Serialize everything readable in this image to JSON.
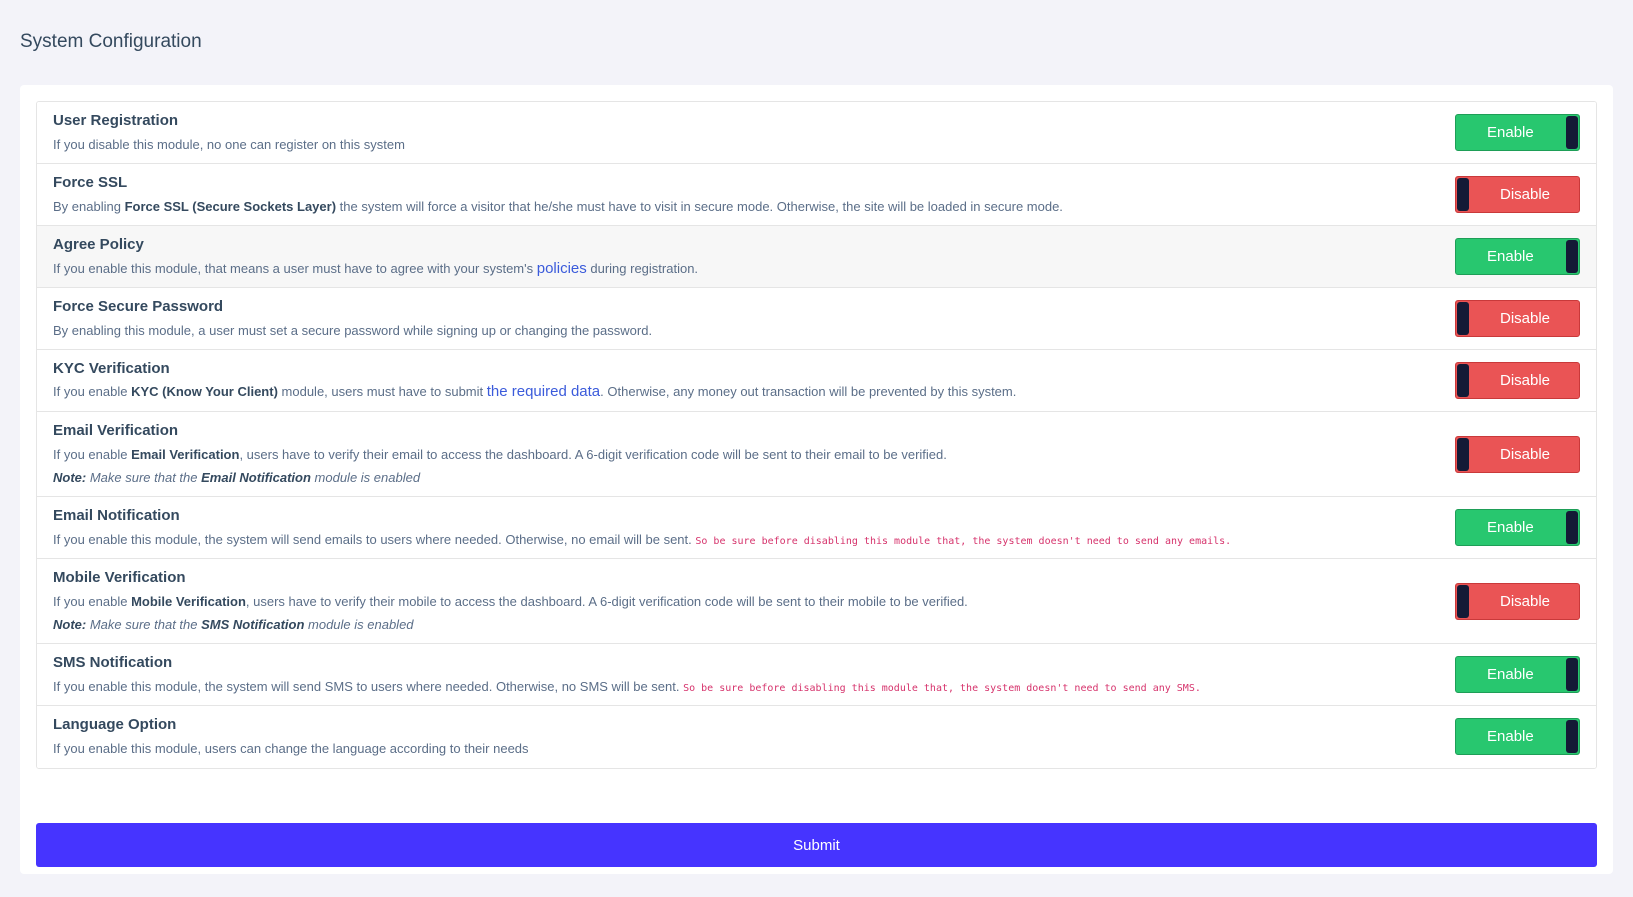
{
  "page": {
    "title": "System Configuration"
  },
  "modules": [
    {
      "title": "User Registration",
      "desc": "If you disable this module, no one can register on this system",
      "state": "Enable"
    },
    {
      "title": "Force SSL",
      "desc_pre": "By enabling ",
      "desc_bold": "Force SSL (Secure Sockets Layer)",
      "desc_post": " the system will force a visitor that he/she must have to visit in secure mode. Otherwise, the site will be loaded in secure mode.",
      "state": "Disable"
    },
    {
      "title": "Agree Policy",
      "desc_pre": "If you enable this module, that means a user must have to agree with your system's ",
      "desc_link": "policies",
      "desc_post": " during registration.",
      "state": "Enable"
    },
    {
      "title": "Force Secure Password",
      "desc": "By enabling this module, a user must set a secure password while signing up or changing the password.",
      "state": "Disable"
    },
    {
      "title": "KYC Verification",
      "desc_pre": "If you enable ",
      "desc_bold": "KYC (Know Your Client)",
      "desc_mid": " module, users must have to submit ",
      "desc_link": "the required data",
      "desc_post": ". Otherwise, any money out transaction will be prevented by this system.",
      "state": "Disable"
    },
    {
      "title": "Email Verification",
      "desc_pre": "If you enable ",
      "desc_bold": "Email Verification",
      "desc_post": ", users have to verify their email to access the dashboard. A 6-digit verification code will be sent to their email to be verified.",
      "note_label": "Note:",
      "note_pre": " Make sure that the ",
      "note_bold": "Email Notification",
      "note_post": " module is enabled",
      "state": "Disable"
    },
    {
      "title": "Email Notification",
      "desc": "If you enable this module, the system will send emails to users where needed. Otherwise, no email will be sent. ",
      "desc_code": "So be sure before disabling this module that, the system doesn't need to send any emails.",
      "state": "Enable"
    },
    {
      "title": "Mobile Verification",
      "desc_pre": "If you enable ",
      "desc_bold": "Mobile Verification",
      "desc_post": ", users have to verify their mobile to access the dashboard. A 6-digit verification code will be sent to their mobile to be verified.",
      "note_label": "Note:",
      "note_pre": " Make sure that the ",
      "note_bold": "SMS Notification",
      "note_post": " module is enabled",
      "state": "Disable"
    },
    {
      "title": "SMS Notification",
      "desc": "If you enable this module, the system will send SMS to users where needed. Otherwise, no SMS will be sent. ",
      "desc_code": "So be sure before disabling this module that, the system doesn't need to send any SMS.",
      "state": "Enable"
    },
    {
      "title": "Language Option",
      "desc": "If you enable this module, users can change the language according to their needs",
      "state": "Enable"
    }
  ],
  "submit_label": "Submit",
  "colors": {
    "enable": "#28c76f",
    "disable": "#ea5455",
    "submit": "#4634ff",
    "knob": "#141a36"
  }
}
